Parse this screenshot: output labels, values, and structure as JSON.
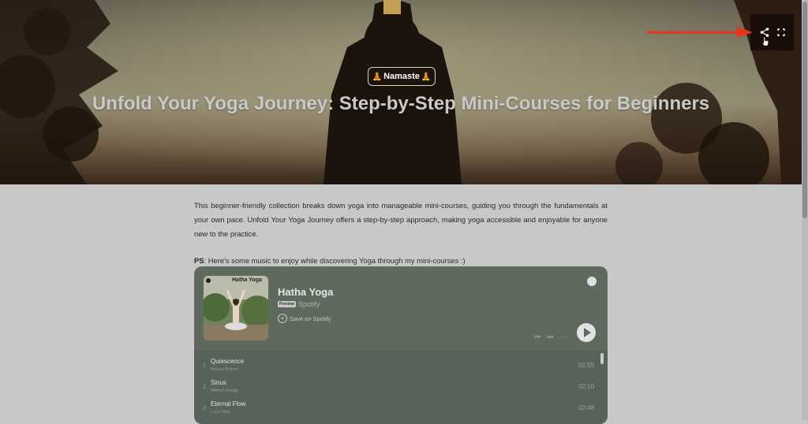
{
  "hero": {
    "badge_text": "Namaste",
    "badge_emoji": "🧘",
    "title": "Unfold Your Yoga Journey: Step-by-Step Mini-Courses for Beginners"
  },
  "toolbar": {
    "icons": [
      "share-icon",
      "fullscreen-icon"
    ]
  },
  "content": {
    "intro": "This beginner-friendly collection breaks down yoga into manageable mini-courses, guiding you through the fundamentals at your own pace. Unfold Your Yoga Journey offers a step-by-step approach, making yoga accessible and enjoyable for anyone new to the practice.",
    "ps_label": "PS",
    "ps_text": ": Here's some music to enjoy while discovering Yoga through my mini-courses :)"
  },
  "player": {
    "cover_label": "Hatha Yoga",
    "title": "Hatha Yoga",
    "preview": "Preview",
    "artist": "Spotify",
    "save_label": "Save on Spotify",
    "tracks": [
      {
        "num": "1",
        "name": "Quiescence",
        "artist": "Nelson Robert",
        "duration": "02:55"
      },
      {
        "num": "2",
        "name": "Sinus",
        "artist": "Wilfred Fredig",
        "duration": "02:10"
      },
      {
        "num": "3",
        "name": "Eternal Flow",
        "artist": "Luka Vida",
        "duration": "02:48"
      }
    ]
  },
  "colors": {
    "accent_arrow": "#e8341c",
    "player_bg": "#5d6a5d",
    "page_bg": "#c8c8c8"
  }
}
